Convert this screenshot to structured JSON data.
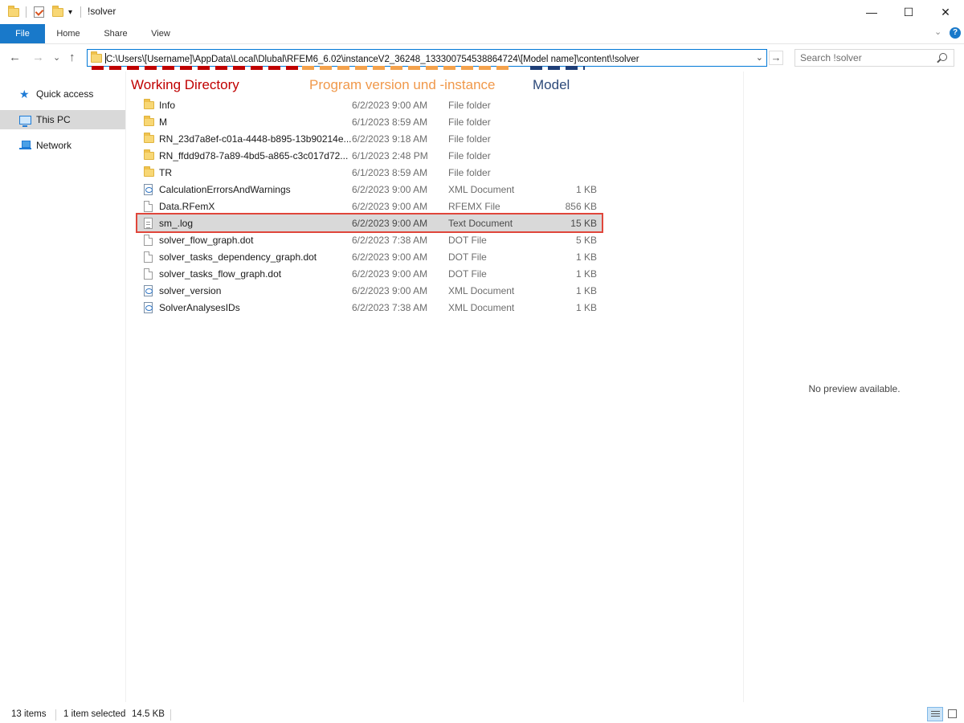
{
  "window": {
    "title": "!solver",
    "minimize_glyph": "—",
    "maximize_glyph": "☐",
    "close_glyph": "✕"
  },
  "ribbon": {
    "tabs": [
      {
        "label": "File"
      },
      {
        "label": "Home"
      },
      {
        "label": "Share"
      },
      {
        "label": "View"
      }
    ],
    "expand_glyph": "⌄",
    "help_glyph": "?"
  },
  "navigation": {
    "back_glyph": "←",
    "forward_glyph": "→",
    "recent_glyph": "⌄",
    "up_glyph": "↑",
    "go_glyph": "→"
  },
  "address": {
    "path": "C:\\Users\\[Username]\\AppData\\Local\\Dlubal\\RFEM6_6.02\\instanceV2_36248_133300754538864724\\[Model name]\\content\\!solver",
    "dropdown_glyph": "⌄"
  },
  "search": {
    "placeholder": "Search !solver"
  },
  "annotations": {
    "working_directory": "Working Directory",
    "program_version": "Program version und -instance",
    "model": "Model",
    "colors": {
      "red": "#c00000",
      "orange": "#f0984a",
      "blue": "#2d4a7a"
    }
  },
  "sidebar": {
    "items": [
      {
        "label": "Quick access",
        "icon": "star-icon"
      },
      {
        "label": "This PC",
        "icon": "computer-icon",
        "selected": true
      },
      {
        "label": "Network",
        "icon": "network-icon"
      }
    ]
  },
  "files": [
    {
      "name": "Info",
      "date": "6/2/2023 9:00 AM",
      "type": "File folder",
      "size": "",
      "icon": "folder-icon"
    },
    {
      "name": "M",
      "date": "6/1/2023 8:59 AM",
      "type": "File folder",
      "size": "",
      "icon": "folder-icon"
    },
    {
      "name": "RN_23d7a8ef-c01a-4448-b895-13b90214e...",
      "date": "6/2/2023 9:18 AM",
      "type": "File folder",
      "size": "",
      "icon": "folder-icon"
    },
    {
      "name": "RN_ffdd9d78-7a89-4bd5-a865-c3c017d72...",
      "date": "6/1/2023 2:48 PM",
      "type": "File folder",
      "size": "",
      "icon": "folder-icon"
    },
    {
      "name": "TR",
      "date": "6/1/2023 8:59 AM",
      "type": "File folder",
      "size": "",
      "icon": "folder-icon"
    },
    {
      "name": "CalculationErrorsAndWarnings",
      "date": "6/2/2023 9:00 AM",
      "type": "XML Document",
      "size": "1 KB",
      "icon": "xml-document-icon"
    },
    {
      "name": "Data.RFemX",
      "date": "6/2/2023 9:00 AM",
      "type": "RFEMX File",
      "size": "856 KB",
      "icon": "file-icon"
    },
    {
      "name": "sm_.log",
      "date": "6/2/2023 9:00 AM",
      "type": "Text Document",
      "size": "15 KB",
      "icon": "text-document-icon",
      "selected": true
    },
    {
      "name": "solver_flow_graph.dot",
      "date": "6/2/2023 7:38 AM",
      "type": "DOT File",
      "size": "5 KB",
      "icon": "file-icon"
    },
    {
      "name": "solver_tasks_dependency_graph.dot",
      "date": "6/2/2023 9:00 AM",
      "type": "DOT File",
      "size": "1 KB",
      "icon": "file-icon"
    },
    {
      "name": "solver_tasks_flow_graph.dot",
      "date": "6/2/2023 9:00 AM",
      "type": "DOT File",
      "size": "1 KB",
      "icon": "file-icon"
    },
    {
      "name": "solver_version",
      "date": "6/2/2023 9:00 AM",
      "type": "XML Document",
      "size": "1 KB",
      "icon": "xml-document-icon"
    },
    {
      "name": "SolverAnalysesIDs",
      "date": "6/2/2023 7:38 AM",
      "type": "XML Document",
      "size": "1 KB",
      "icon": "xml-document-icon"
    }
  ],
  "preview": {
    "message": "No preview available."
  },
  "status": {
    "item_count": "13 items",
    "selection": "1 item selected",
    "selection_size": "14.5 KB"
  }
}
